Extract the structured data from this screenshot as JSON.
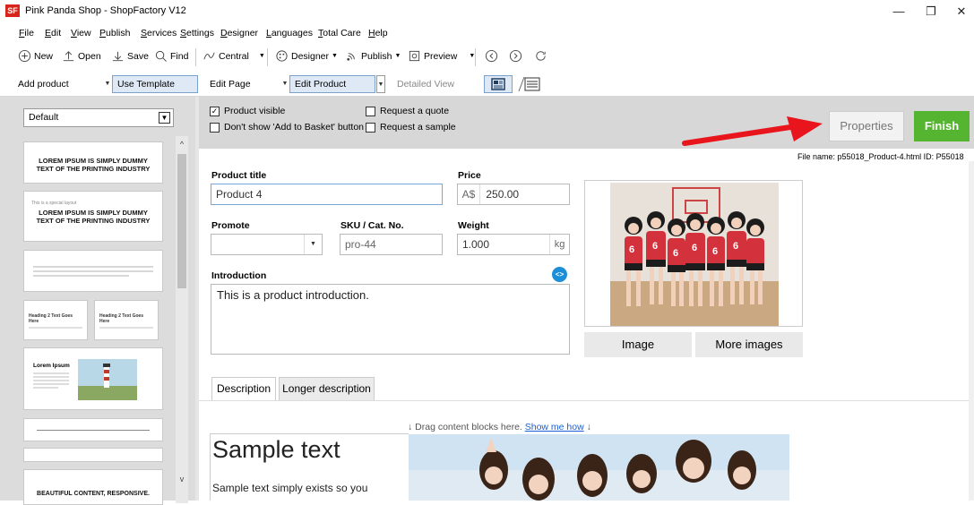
{
  "window": {
    "title": "Pink Panda Shop - ShopFactory V12",
    "logo": "SF",
    "minimize": "—",
    "restore": "❐",
    "close": "✕"
  },
  "menu": [
    "File",
    "Edit",
    "View",
    "Publish",
    "Services",
    "Settings",
    "Designer",
    "Languages",
    "Total Care",
    "Help"
  ],
  "toolbar": {
    "new": "New",
    "open": "Open",
    "save": "Save",
    "find": "Find",
    "central": "Central",
    "designer": "Designer",
    "publish": "Publish",
    "preview": "Preview"
  },
  "toolbar2": {
    "add_product": "Add product",
    "use_template": "Use Template",
    "edit_page": "Edit Page",
    "edit_product": "Edit Product",
    "detailed_view": "Detailed View"
  },
  "left_panel": {
    "template_select": "Default",
    "cards": {
      "card1_title": "LOREM IPSUM IS SIMPLY DUMMY TEXT OF THE PRINTING INDUSTRY",
      "card2_small": "This is a special layout",
      "card2_title": "LOREM IPSUM IS SIMPLY DUMMY TEXT OF THE PRINTING INDUSTRY",
      "card4_left": "Heading 2 Text Goes Here",
      "card4_right": "Heading 2 Text Goes Here",
      "card5_title": "Lorem Ipsum",
      "card8_title": "BEAUTIFUL CONTENT, RESPONSIVE."
    }
  },
  "options": {
    "product_visible": "Product visible",
    "dont_show_basket": "Don't show 'Add to Basket' button",
    "request_quote": "Request a quote",
    "request_sample": "Request a sample"
  },
  "buttons": {
    "properties": "Properties",
    "finish": "Finish"
  },
  "file_info": "File name: p55018_Product-4.html   ID: P55018",
  "form": {
    "product_title_label": "Product title",
    "product_title_value": "Product 4",
    "price_label": "Price",
    "currency": "A$",
    "price_value": "250.00",
    "promote_label": "Promote",
    "sku_label": "SKU / Cat. No.",
    "sku_value": "pro-44",
    "weight_label": "Weight",
    "weight_value": "1.000",
    "weight_unit": "kg",
    "introduction_label": "Introduction",
    "introduction_value": "This is a product introduction."
  },
  "image_buttons": {
    "image": "Image",
    "more_images": "More images"
  },
  "tabs": [
    "Description",
    "Longer description"
  ],
  "content": {
    "drag_hint": "Drag content blocks here.",
    "show_me_how": "Show me how",
    "sample_heading": "Sample text",
    "sample_body": "Sample text simply exists so you"
  },
  "colors": {
    "finish": "#55b530",
    "arrow": "#e8161c",
    "active_tool": "#dfe9f5",
    "link": "#1a5fd6"
  }
}
